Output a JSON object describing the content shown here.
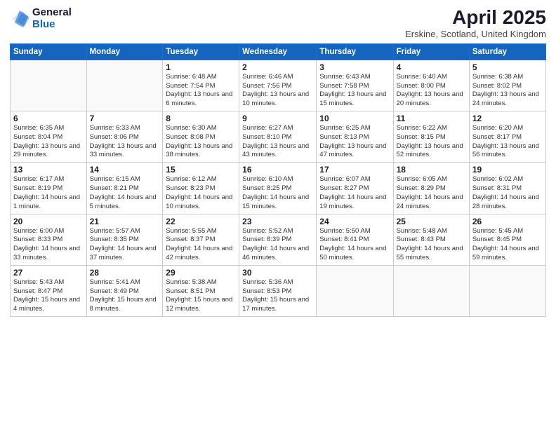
{
  "logo": {
    "general": "General",
    "blue": "Blue"
  },
  "header": {
    "title": "April 2025",
    "subtitle": "Erskine, Scotland, United Kingdom"
  },
  "weekdays": [
    "Sunday",
    "Monday",
    "Tuesday",
    "Wednesday",
    "Thursday",
    "Friday",
    "Saturday"
  ],
  "weeks": [
    [
      {
        "day": "",
        "info": ""
      },
      {
        "day": "",
        "info": ""
      },
      {
        "day": "1",
        "info": "Sunrise: 6:48 AM\nSunset: 7:54 PM\nDaylight: 13 hours and 6 minutes."
      },
      {
        "day": "2",
        "info": "Sunrise: 6:46 AM\nSunset: 7:56 PM\nDaylight: 13 hours and 10 minutes."
      },
      {
        "day": "3",
        "info": "Sunrise: 6:43 AM\nSunset: 7:58 PM\nDaylight: 13 hours and 15 minutes."
      },
      {
        "day": "4",
        "info": "Sunrise: 6:40 AM\nSunset: 8:00 PM\nDaylight: 13 hours and 20 minutes."
      },
      {
        "day": "5",
        "info": "Sunrise: 6:38 AM\nSunset: 8:02 PM\nDaylight: 13 hours and 24 minutes."
      }
    ],
    [
      {
        "day": "6",
        "info": "Sunrise: 6:35 AM\nSunset: 8:04 PM\nDaylight: 13 hours and 29 minutes."
      },
      {
        "day": "7",
        "info": "Sunrise: 6:33 AM\nSunset: 8:06 PM\nDaylight: 13 hours and 33 minutes."
      },
      {
        "day": "8",
        "info": "Sunrise: 6:30 AM\nSunset: 8:08 PM\nDaylight: 13 hours and 38 minutes."
      },
      {
        "day": "9",
        "info": "Sunrise: 6:27 AM\nSunset: 8:10 PM\nDaylight: 13 hours and 43 minutes."
      },
      {
        "day": "10",
        "info": "Sunrise: 6:25 AM\nSunset: 8:13 PM\nDaylight: 13 hours and 47 minutes."
      },
      {
        "day": "11",
        "info": "Sunrise: 6:22 AM\nSunset: 8:15 PM\nDaylight: 13 hours and 52 minutes."
      },
      {
        "day": "12",
        "info": "Sunrise: 6:20 AM\nSunset: 8:17 PM\nDaylight: 13 hours and 56 minutes."
      }
    ],
    [
      {
        "day": "13",
        "info": "Sunrise: 6:17 AM\nSunset: 8:19 PM\nDaylight: 14 hours and 1 minute."
      },
      {
        "day": "14",
        "info": "Sunrise: 6:15 AM\nSunset: 8:21 PM\nDaylight: 14 hours and 5 minutes."
      },
      {
        "day": "15",
        "info": "Sunrise: 6:12 AM\nSunset: 8:23 PM\nDaylight: 14 hours and 10 minutes."
      },
      {
        "day": "16",
        "info": "Sunrise: 6:10 AM\nSunset: 8:25 PM\nDaylight: 14 hours and 15 minutes."
      },
      {
        "day": "17",
        "info": "Sunrise: 6:07 AM\nSunset: 8:27 PM\nDaylight: 14 hours and 19 minutes."
      },
      {
        "day": "18",
        "info": "Sunrise: 6:05 AM\nSunset: 8:29 PM\nDaylight: 14 hours and 24 minutes."
      },
      {
        "day": "19",
        "info": "Sunrise: 6:02 AM\nSunset: 8:31 PM\nDaylight: 14 hours and 28 minutes."
      }
    ],
    [
      {
        "day": "20",
        "info": "Sunrise: 6:00 AM\nSunset: 8:33 PM\nDaylight: 14 hours and 33 minutes."
      },
      {
        "day": "21",
        "info": "Sunrise: 5:57 AM\nSunset: 8:35 PM\nDaylight: 14 hours and 37 minutes."
      },
      {
        "day": "22",
        "info": "Sunrise: 5:55 AM\nSunset: 8:37 PM\nDaylight: 14 hours and 42 minutes."
      },
      {
        "day": "23",
        "info": "Sunrise: 5:52 AM\nSunset: 8:39 PM\nDaylight: 14 hours and 46 minutes."
      },
      {
        "day": "24",
        "info": "Sunrise: 5:50 AM\nSunset: 8:41 PM\nDaylight: 14 hours and 50 minutes."
      },
      {
        "day": "25",
        "info": "Sunrise: 5:48 AM\nSunset: 8:43 PM\nDaylight: 14 hours and 55 minutes."
      },
      {
        "day": "26",
        "info": "Sunrise: 5:45 AM\nSunset: 8:45 PM\nDaylight: 14 hours and 59 minutes."
      }
    ],
    [
      {
        "day": "27",
        "info": "Sunrise: 5:43 AM\nSunset: 8:47 PM\nDaylight: 15 hours and 4 minutes."
      },
      {
        "day": "28",
        "info": "Sunrise: 5:41 AM\nSunset: 8:49 PM\nDaylight: 15 hours and 8 minutes."
      },
      {
        "day": "29",
        "info": "Sunrise: 5:38 AM\nSunset: 8:51 PM\nDaylight: 15 hours and 12 minutes."
      },
      {
        "day": "30",
        "info": "Sunrise: 5:36 AM\nSunset: 8:53 PM\nDaylight: 15 hours and 17 minutes."
      },
      {
        "day": "",
        "info": ""
      },
      {
        "day": "",
        "info": ""
      },
      {
        "day": "",
        "info": ""
      }
    ]
  ]
}
